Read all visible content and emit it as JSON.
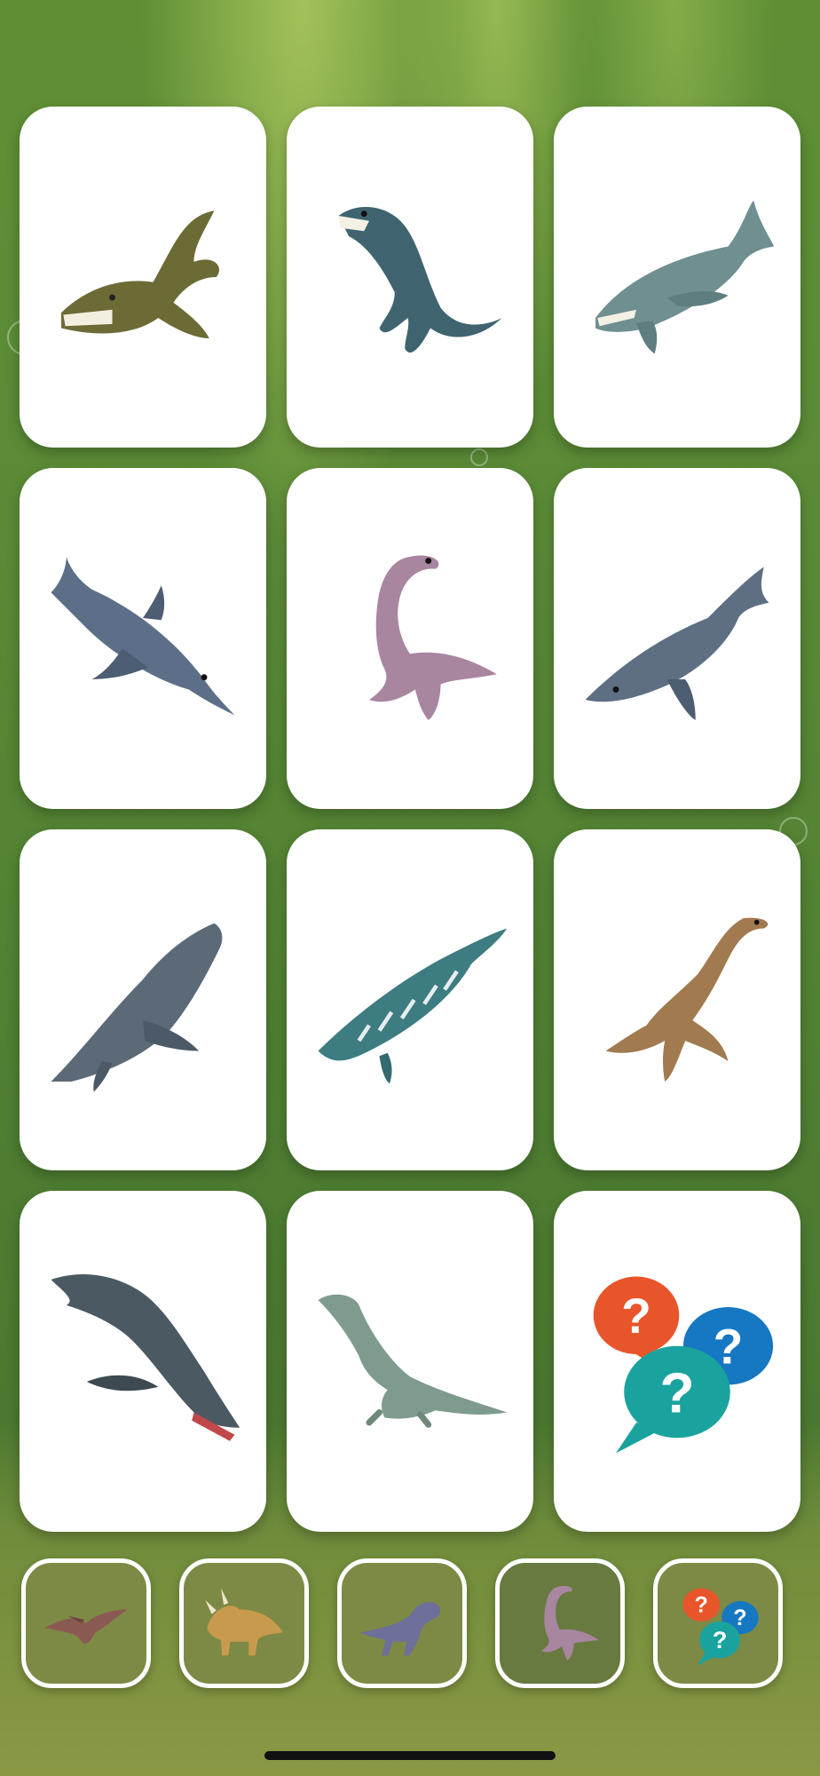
{
  "grid": {
    "cards": [
      {
        "name": "card-tylosaurus",
        "icon": "tylosaurus-icon",
        "fill": "#6c6b36"
      },
      {
        "name": "card-nothosaurus",
        "icon": "nothosaurus-icon",
        "fill": "#3f6470"
      },
      {
        "name": "card-liopleurodon",
        "icon": "liopleurodon-icon",
        "fill": "#6f8f90"
      },
      {
        "name": "card-ichthyosaurus",
        "icon": "ichthyosaurus-icon",
        "fill": "#5d6f88"
      },
      {
        "name": "card-elasmosaurus-pink",
        "icon": "elasmosaurus-icon",
        "fill": "#a8869f"
      },
      {
        "name": "card-ophthalmosaurus",
        "icon": "ophthalmosaurus-icon",
        "fill": "#5e6f84"
      },
      {
        "name": "card-kronosaurus",
        "icon": "kronosaurus-icon",
        "fill": "#5c6a78"
      },
      {
        "name": "card-mosasaurus-striped",
        "icon": "mosasaurus-icon",
        "fill": "#3d7c80"
      },
      {
        "name": "card-plesiosaurus",
        "icon": "plesiosaurus-icon",
        "fill": "#a17a4f"
      },
      {
        "name": "card-mosasaurus-dark",
        "icon": "mosasaurus-dark-icon",
        "fill": "#4b5a62"
      },
      {
        "name": "card-brachauchenius",
        "icon": "sea-reptile-icon",
        "fill": "#7f9b8e"
      },
      {
        "name": "card-quiz",
        "icon": "question-bubbles-icon",
        "fill": "#1a9f9c"
      }
    ]
  },
  "tabs": [
    {
      "name": "tab-flying-reptiles",
      "icon": "pterodactyl-icon",
      "selected": false
    },
    {
      "name": "tab-horned-dinosaurs",
      "icon": "triceratops-icon",
      "selected": false
    },
    {
      "name": "tab-predators",
      "icon": "raptor-icon",
      "selected": false
    },
    {
      "name": "tab-sea-reptiles",
      "icon": "plesiosaur-icon",
      "selected": true
    },
    {
      "name": "tab-quiz",
      "icon": "question-bubbles-icon",
      "selected": false
    }
  ],
  "colors": {
    "question_orange": "#e8552b",
    "question_teal": "#1aa39e",
    "question_blue": "#1677c3"
  }
}
